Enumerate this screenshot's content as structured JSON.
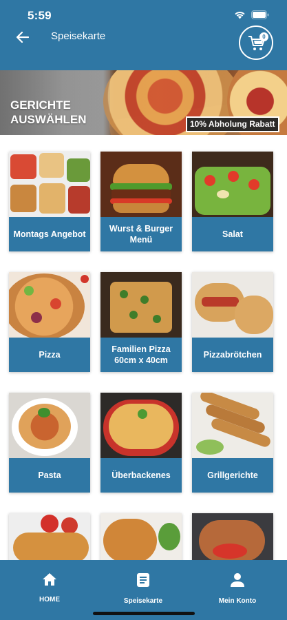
{
  "status_bar": {
    "time": "5:59"
  },
  "header": {
    "title": "Speisekarte",
    "cart_count": "0"
  },
  "hero": {
    "heading": "GERICHTE AUSWÄHLEN",
    "badge": "10% Abholung Rabatt"
  },
  "menu": {
    "items": [
      {
        "label": "Montags Angebot"
      },
      {
        "label": "Wurst & Burger Menü"
      },
      {
        "label": "Salat"
      },
      {
        "label": "Pizza"
      },
      {
        "label": "Familien Pizza 60cm x 40cm"
      },
      {
        "label": "Pizzabrötchen"
      },
      {
        "label": "Pasta"
      },
      {
        "label": "Überbackenes"
      },
      {
        "label": "Grillgerichte"
      },
      {
        "label": ""
      },
      {
        "label": ""
      },
      {
        "label": ""
      }
    ]
  },
  "nav": {
    "items": [
      {
        "label": "HOME",
        "icon": "home-icon"
      },
      {
        "label": "Speisekarte",
        "icon": "menu-document-icon"
      },
      {
        "label": "Mein Konto",
        "icon": "account-icon"
      }
    ]
  },
  "colors": {
    "primary": "#2f77a4",
    "white": "#ffffff"
  }
}
